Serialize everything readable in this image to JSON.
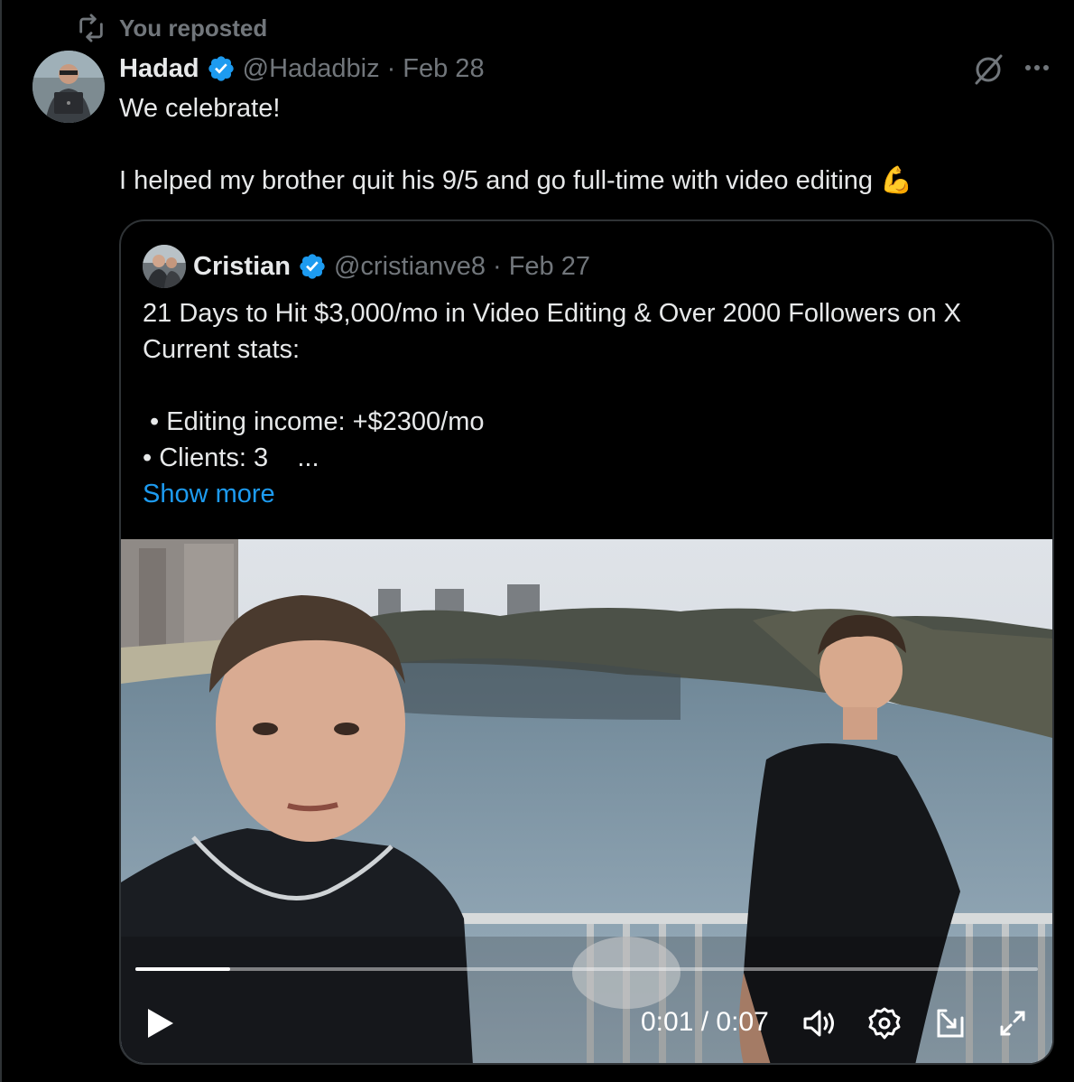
{
  "repost": {
    "label": "You reposted",
    "icon": "repost-icon"
  },
  "tweet": {
    "author_name": "Hadad",
    "handle": "@Hadadbiz",
    "separator": "·",
    "date": "Feb 28",
    "text_line1": "We celebrate!",
    "text_line3": "I helped my brother quit his 9/5 and go full-time with video editing",
    "emoji": "💪"
  },
  "quote": {
    "author_name": "Cristian",
    "handle": "@cristianve8",
    "separator": "·",
    "date": "Feb 27",
    "line1": "21 Days to Hit $3,000/mo in Video Editing & Over 2000 Followers on X",
    "line2": "Current stats:",
    "line4": " • Editing income: +$2300/mo",
    "line5": "• Clients: 3    ...",
    "show_more": "Show more"
  },
  "video": {
    "current_time": "0:01",
    "divider": "/",
    "duration": "0:07",
    "progress": 0.105,
    "controls": [
      "play-icon",
      "volume-icon",
      "settings-icon",
      "pip-icon",
      "fullscreen-icon"
    ]
  },
  "colors": {
    "accent": "#1d9bf0",
    "muted": "#71767b",
    "text": "#e7e9ea",
    "border": "#2f3336"
  }
}
